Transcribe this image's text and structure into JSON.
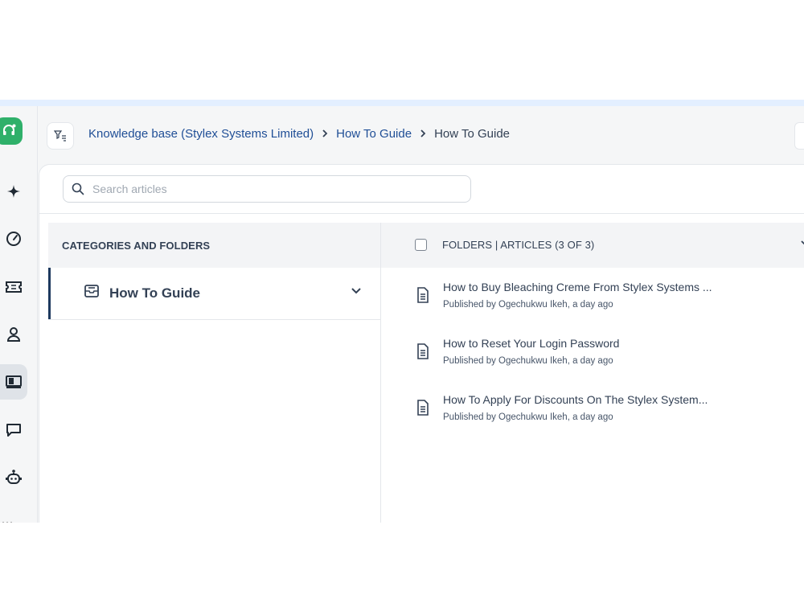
{
  "header": {
    "breadcrumb": [
      {
        "label": "Knowledge base (Stylex Systems Limited)"
      },
      {
        "label": "How To Guide"
      },
      {
        "label": "How To Guide"
      }
    ]
  },
  "search": {
    "placeholder": "Search articles",
    "value": ""
  },
  "rail": {
    "items": [
      {
        "icon": "sparkle-icon"
      },
      {
        "icon": "dashboard-gauge-icon"
      },
      {
        "icon": "ticket-icon"
      },
      {
        "icon": "contacts-person-icon"
      },
      {
        "icon": "knowledge-base-book-icon",
        "active": true
      },
      {
        "icon": "chat-icon"
      },
      {
        "icon": "bot-icon"
      }
    ]
  },
  "categories": {
    "header": "CATEGORIES AND FOLDERS",
    "items": [
      {
        "label": "How To Guide"
      }
    ]
  },
  "articles": {
    "header": "FOLDERS | ARTICLES (3 OF 3)",
    "items": [
      {
        "title": "How to Buy Bleaching Creme From Stylex Systems ...",
        "meta": "Published by Ogechukwu Ikeh, a day ago"
      },
      {
        "title": "How to Reset Your Login Password",
        "meta": "Published by Ogechukwu Ikeh, a day ago"
      },
      {
        "title": "How To Apply For Discounts On The Stylex System...",
        "meta": "Published by Ogechukwu Ikeh, a day ago"
      }
    ]
  },
  "colors": {
    "accent": "#2fb06a",
    "link": "#1f4e96",
    "active_bar": "#1e3a5f"
  }
}
